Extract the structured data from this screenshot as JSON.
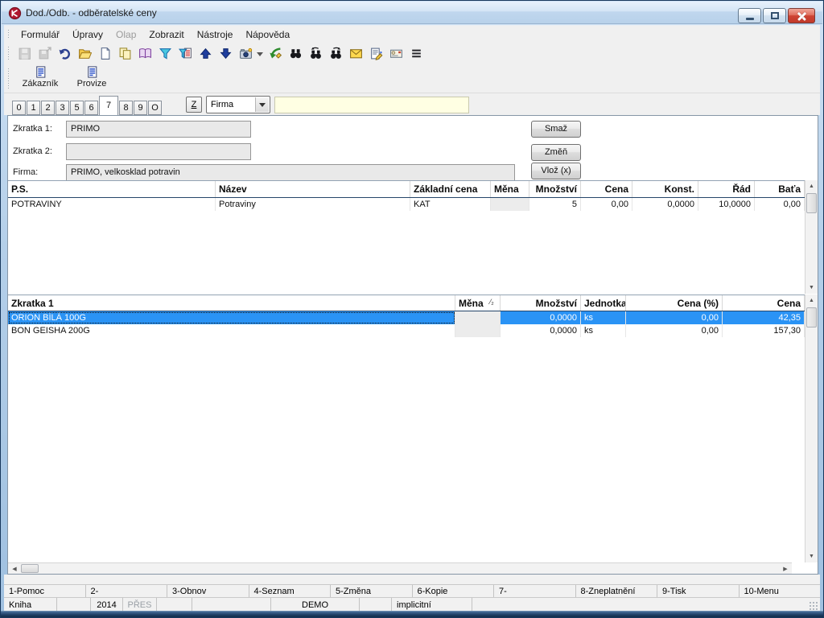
{
  "window": {
    "title": "Dod./Odb. - odběratelské ceny",
    "icon": "k2-logo",
    "controls": [
      "minimize",
      "restore",
      "close"
    ]
  },
  "menu": {
    "items": [
      {
        "label": "Formulář",
        "enabled": true
      },
      {
        "label": "Úpravy",
        "enabled": true
      },
      {
        "label": "Olap",
        "enabled": false
      },
      {
        "label": "Zobrazit",
        "enabled": true
      },
      {
        "label": "Nástroje",
        "enabled": true
      },
      {
        "label": "Nápověda",
        "enabled": true
      }
    ]
  },
  "toolbar": {
    "icons": [
      "save",
      "save-as",
      "undo",
      "open",
      "new",
      "copy",
      "book",
      "filter",
      "filter-report",
      "move-up",
      "move-down",
      "snapshot",
      "snapshot-dropdown",
      "export-edit",
      "find",
      "find-previous",
      "find-next",
      "send-mail",
      "edit-document",
      "mail-message",
      "list-menu"
    ]
  },
  "quick_buttons": [
    {
      "label": "Zákazník",
      "icon": "form-icon"
    },
    {
      "label": "Provize",
      "icon": "form-icon"
    }
  ],
  "tab_bar": {
    "tabs": [
      "0",
      "1",
      "2",
      "3",
      "5",
      "6",
      "7",
      "8",
      "9",
      "O"
    ],
    "active_tab": "7",
    "z_button": "Z",
    "lookup_selector": "Firma",
    "search_value": ""
  },
  "form": {
    "fields": [
      {
        "label": "Zkratka 1:",
        "value": "PRIMO"
      },
      {
        "label": "Zkratka 2:",
        "value": ""
      },
      {
        "label": "Firma:",
        "value": "PRIMO, velkosklad potravin"
      }
    ],
    "buttons": [
      {
        "label": "Smaž"
      },
      {
        "label": "Změň"
      },
      {
        "label": "Vlož (x)"
      }
    ]
  },
  "price_groups_table": {
    "columns": [
      "P.S.",
      "Název",
      "Základní cena",
      "Měna",
      "Množství",
      "Cena",
      "Konst.",
      "Řád",
      "Baťa"
    ],
    "rows": [
      [
        "POTRAVINY",
        "Potraviny",
        "KAT",
        "",
        "5",
        "0,00",
        "0,0000",
        "10,0000",
        "0,00"
      ]
    ]
  },
  "items_table": {
    "columns": [
      "Zkratka 1",
      "Měna",
      "Množství",
      "Jednotka",
      "Cena (%)",
      "Cena"
    ],
    "sort_indicator": "⁄₂",
    "rows": [
      {
        "cells": [
          "ORION BÍLÁ 100G",
          "",
          "0,0000",
          "ks",
          "0,00",
          "42,35"
        ],
        "selected": true
      },
      {
        "cells": [
          "BON GEISHA 200G",
          "",
          "0,0000",
          "ks",
          "0,00",
          "157,30"
        ],
        "selected": false
      }
    ]
  },
  "function_keys": [
    "1-Pomoc",
    "2-",
    "3-Obnov",
    "4-Seznam",
    "5-Změna",
    "6-Kopie",
    "7-",
    "8-Zneplatnění",
    "9-Tisk",
    "10-Menu"
  ],
  "status_bar": [
    "Kniha",
    "",
    "2014",
    "PŘES",
    "",
    "",
    "DEMO",
    "",
    "implicitní",
    ""
  ],
  "colors": {
    "selection": "#2a93f5",
    "highlight_field": "#ffffe3",
    "close_button": "#ce4434",
    "disabled_text": "#9b9b9b"
  }
}
